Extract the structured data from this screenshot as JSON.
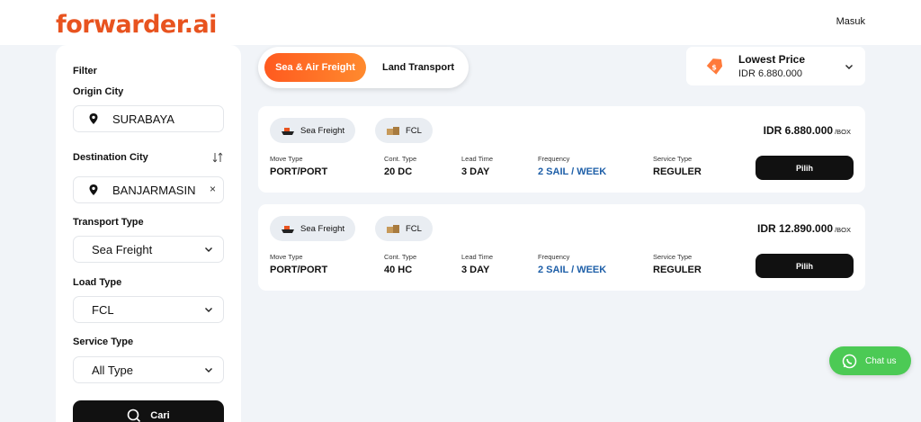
{
  "header": {
    "logo_text": "forwarder.ai",
    "login_label": "Masuk"
  },
  "sidebar": {
    "filter_label": "Filter",
    "origin_label": "Origin City",
    "origin_value": "SURABAYA",
    "destination_label": "Destination City",
    "destination_value": "BANJARMASIN",
    "clear_symbol": "×",
    "transport_label": "Transport Type",
    "transport_value": "Sea Freight",
    "load_label": "Load Type",
    "load_value": "FCL",
    "service_label": "Service Type",
    "service_value": "All Type",
    "search_button": "Cari"
  },
  "mode_toggle": {
    "active": "Sea & Air Freight",
    "inactive": "Land Transport"
  },
  "sort": {
    "title": "Lowest Price",
    "value": "IDR 6.880.000"
  },
  "results": [
    {
      "transport": "Sea Freight",
      "load": "FCL",
      "price": "IDR 6.880.000",
      "unit": "/BOX",
      "move_type_label": "Move Type",
      "move_type": "PORT/PORT",
      "cont_type_label": "Cont. Type",
      "cont_type": "20 DC",
      "lead_time_label": "Lead Time",
      "lead_time": "3 DAY",
      "frequency_label": "Frequency",
      "frequency": "2 SAIL / WEEK",
      "service_type_label": "Service Type",
      "service_type": "REGULER",
      "action": "Pilih"
    },
    {
      "transport": "Sea Freight",
      "load": "FCL",
      "price": "IDR 12.890.000",
      "unit": "/BOX",
      "move_type_label": "Move Type",
      "move_type": "PORT/PORT",
      "cont_type_label": "Cont. Type",
      "cont_type": "40 HC",
      "lead_time_label": "Lead Time",
      "lead_time": "3 DAY",
      "frequency_label": "Frequency",
      "frequency": "2 SAIL / WEEK",
      "service_type_label": "Service Type",
      "service_type": "REGULER",
      "action": "Pilih"
    }
  ],
  "chat": {
    "label": "Chat us"
  },
  "colors": {
    "brand": "#e8531f",
    "accent_gradient_start": "#ff5a1f",
    "accent_gradient_end": "#ff8a2e",
    "link_blue": "#1e5fa8",
    "chat_green": "#4cca55"
  },
  "icons": {
    "pin": "map-pin-icon",
    "swap": "swap-icon",
    "chevron": "chevron-down-icon",
    "search": "search-icon",
    "tag": "price-tag-icon",
    "ship": "ship-icon",
    "box": "container-box-icon",
    "whatsapp": "whatsapp-icon"
  }
}
